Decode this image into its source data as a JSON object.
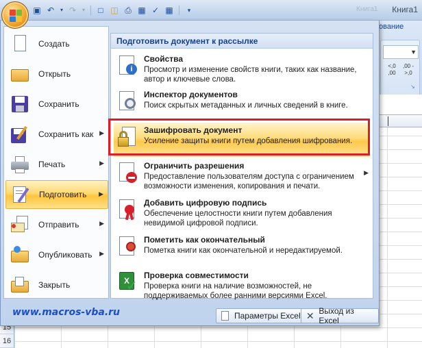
{
  "window": {
    "title": "Книга1",
    "title_faded": "Книга1"
  },
  "ribbon": {
    "tab_fragment": "ование",
    "dec_more": "<,0 ,00",
    "dec_less": ",00 ->,0"
  },
  "menu": {
    "left_items": [
      {
        "label": "Создать",
        "icon": "new-document-icon",
        "submenu": false
      },
      {
        "label": "Открыть",
        "icon": "open-folder-icon",
        "submenu": false
      },
      {
        "label": "Сохранить",
        "icon": "save-floppy-icon",
        "submenu": false
      },
      {
        "label": "Сохранить как",
        "icon": "save-as-icon",
        "submenu": true
      },
      {
        "label": "Печать",
        "icon": "printer-icon",
        "submenu": true
      },
      {
        "label": "Подготовить",
        "icon": "prepare-pen-icon",
        "submenu": true,
        "active": true
      },
      {
        "label": "Отправить",
        "icon": "send-envelope-icon",
        "submenu": true
      },
      {
        "label": "Опубликовать",
        "icon": "publish-folder-icon",
        "submenu": true
      },
      {
        "label": "Закрыть",
        "icon": "close-folder-icon",
        "submenu": false
      }
    ],
    "right_title": "Подготовить документ к рассылке",
    "right_items": [
      {
        "title": "Свойства",
        "desc": "Просмотр и изменение свойств книги, таких как название, автор и ключевые слова.",
        "icon": "properties-icon"
      },
      {
        "title": "Инспектор документов",
        "desc": "Поиск скрытых метаданных и личных сведений в книге.",
        "icon": "inspector-icon"
      },
      {
        "title": "Зашифровать документ",
        "desc": "Усиление защиты книги путем добавления шифрования.",
        "icon": "encrypt-lock-icon"
      },
      {
        "title": "Ограничить разрешения",
        "desc": "Предоставление пользователям доступа с ограничением возможности изменения, копирования и печати.",
        "icon": "restrict-permission-icon",
        "submenu": true
      },
      {
        "title": "Добавить цифровую подпись",
        "desc": "Обеспечение целостности книги путем добавления невидимой цифровой подписи.",
        "icon": "digital-signature-icon"
      },
      {
        "title": "Пометить как окончательный",
        "desc": "Пометка книги как окончательной и нередактируемой.",
        "icon": "mark-final-icon"
      },
      {
        "title": "Проверка совместимости",
        "desc": "Проверка книги на наличие возможностей, не поддерживаемых более ранними версиями Excel.",
        "icon": "compatibility-check-icon"
      }
    ],
    "options_button": "Параметры Excel",
    "exit_button": "Выход из Excel"
  },
  "watermark": "www.macros-vba.ru",
  "rows": [
    "15",
    "16"
  ],
  "colors": {
    "highlight_border": "#d8202c",
    "accent_text": "#15428b",
    "watermark": "#1d4fc4"
  }
}
